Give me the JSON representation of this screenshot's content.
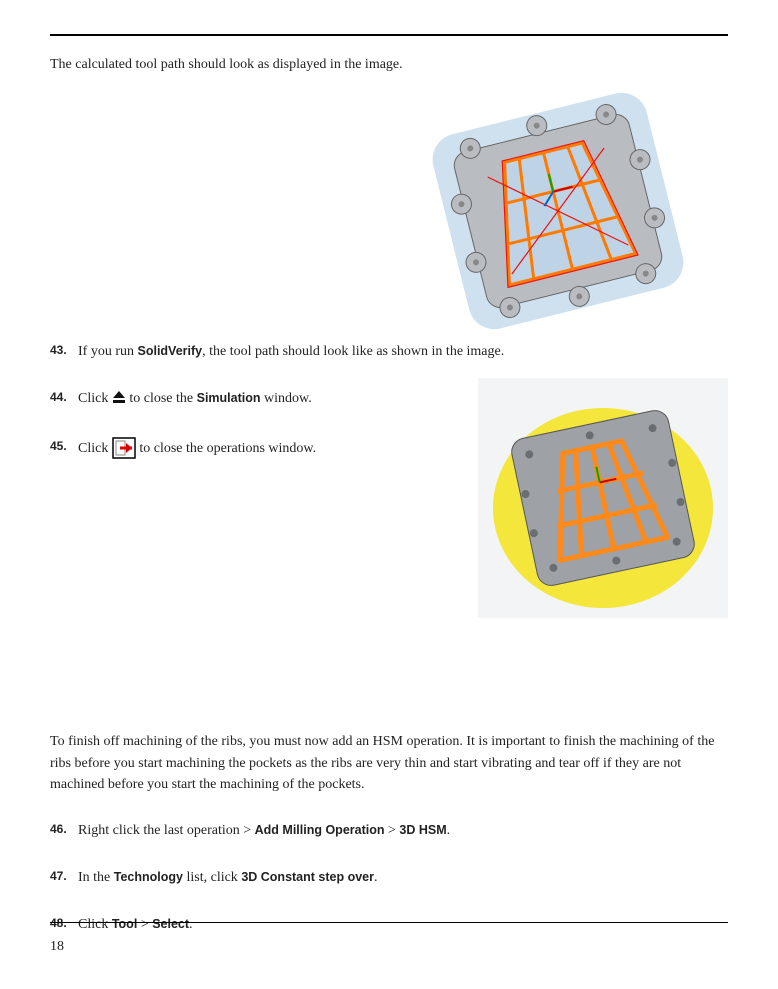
{
  "page_number": "18",
  "intro1": "The calculated tool path should look as displayed in the image.",
  "steps": {
    "s43": {
      "num": "43.",
      "pre": "If you run ",
      "b1": "SolidVerify",
      "post": ", the tool path should look like as shown in the image."
    },
    "s44": {
      "num": "44.",
      "pre": "Click ",
      "mid": " to close the ",
      "b1": "Simulation",
      "post": " window."
    },
    "s45": {
      "num": "45.",
      "pre": "Click ",
      "post": " to close the operations window."
    }
  },
  "body2": "To finish off machining of the ribs, you must now add an HSM operation. It is important to finish the machining of the ribs before you start machining the pockets as the ribs are very thin and start vibrating and tear off if they are not machined before you start the machining of the pockets.",
  "steps2": {
    "s46": {
      "num": "46.",
      "t1": "Right click the last operation > ",
      "b1": "Add Milling Operation",
      "t2": " > ",
      "b2": "3D HSM",
      "t3": "."
    },
    "s47": {
      "num": "47.",
      "t1": "In the ",
      "b1": "Technology",
      "t2": " list, click ",
      "b2": "3D Constant step over",
      "t3": "."
    },
    "s48": {
      "num": "48.",
      "t1": "Click ",
      "b1": "Tool",
      "t2": " > ",
      "b2": "Select",
      "t3": "."
    }
  },
  "icons": {
    "eject": "eject-icon",
    "exit": "exit-icon"
  }
}
